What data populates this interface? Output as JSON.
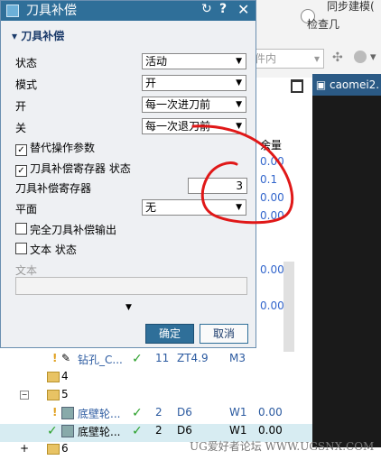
{
  "background": {
    "top_title": "同步建模(",
    "top_check": "检查几",
    "filter_value": "件内",
    "tab_label": "caomei2.",
    "col_header": "余量",
    "col_values": [
      "0.00",
      "0.1",
      "0.00",
      "0.00",
      "0.00",
      "0.00"
    ],
    "tree": [
      {
        "name": "钻孔_C...",
        "status": "✓",
        "num": "11",
        "tool": "ZT4.9",
        "method": "M3",
        "stock": ""
      },
      {
        "name": "4",
        "folder": true
      },
      {
        "name": "5",
        "folder": true
      },
      {
        "name": "底壁轮...",
        "status": "✓",
        "num": "2",
        "tool": "D6",
        "method": "W1",
        "stock": "0.00"
      },
      {
        "name": "底壁轮...",
        "status": "✓",
        "num": "2",
        "tool": "D6",
        "method": "W1",
        "stock": "0.00"
      },
      {
        "name": "6",
        "folder": true
      }
    ]
  },
  "dialog": {
    "title": "刀具补偿",
    "section": "刀具补偿",
    "state_label": "状态",
    "state_value": "活动",
    "mode_label": "模式",
    "mode_value": "开",
    "on_label": "开",
    "on_value": "每一次进刀前",
    "off_label": "关",
    "off_value": "每一次退刀前",
    "alt_params": "替代操作参数",
    "reg_status": "刀具补偿寄存器 状态",
    "reg_label": "刀具补偿寄存器",
    "reg_value": "3",
    "plane_label": "平面",
    "plane_value": "无",
    "full_output": "完全刀具补偿输出",
    "text_status": "文本 状态",
    "text_label": "文本",
    "ok": "确定",
    "cancel": "取消"
  },
  "watermark": "UG爱好者论坛 WWW.UGSNX.COM"
}
